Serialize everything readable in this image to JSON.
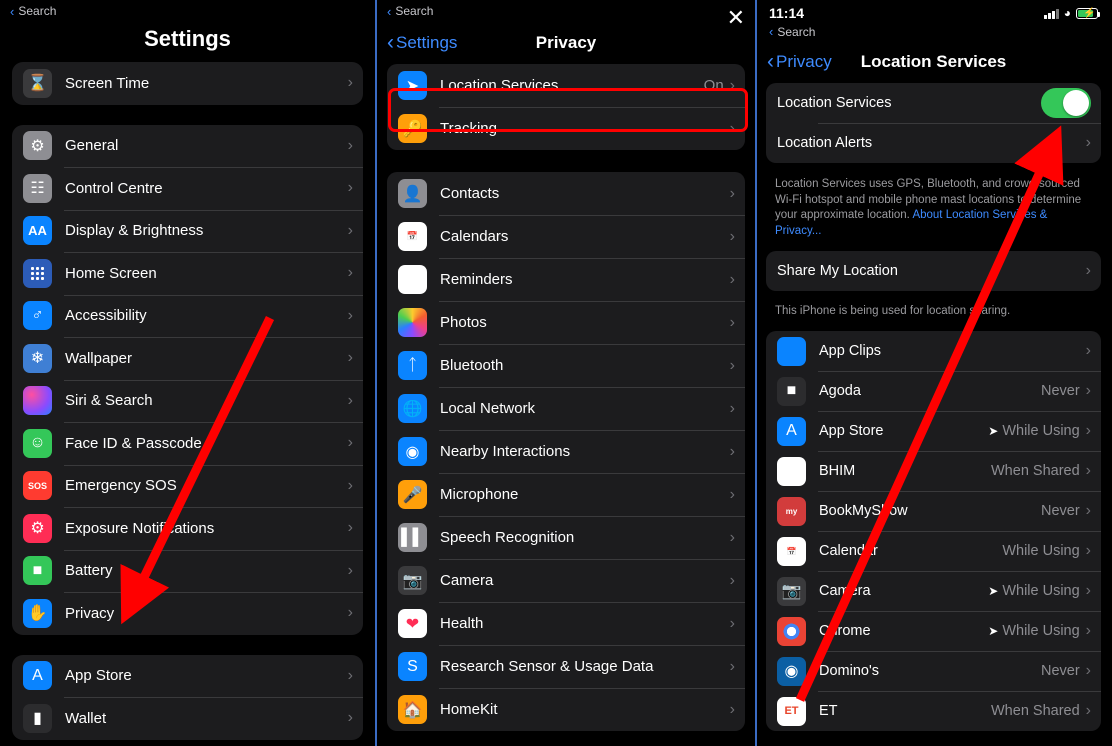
{
  "colors": {
    "accent_blue": "#0a84ff",
    "tint_blue": "#3e8bff",
    "green": "#34c759",
    "highlight_red": "#ff0000",
    "panel_bg": "#1c1c1e",
    "secondary_text": "#8e8e93"
  },
  "panel1": {
    "search_remnant": "Search",
    "title": "Settings",
    "group1": [
      {
        "label": "Screen Time",
        "icon": "hourglass-icon",
        "value": "",
        "chevron": "›"
      }
    ],
    "group2": [
      {
        "label": "General",
        "icon": "gear-icon",
        "value": "",
        "chevron": "›"
      },
      {
        "label": "Control Centre",
        "icon": "control-centre-icon",
        "value": "",
        "chevron": "›"
      },
      {
        "label": "Display & Brightness",
        "icon": "display-brightness-icon",
        "value": "",
        "chevron": "›"
      },
      {
        "label": "Home Screen",
        "icon": "home-screen-icon",
        "value": "",
        "chevron": "›"
      },
      {
        "label": "Accessibility",
        "icon": "accessibility-icon",
        "value": "",
        "chevron": "›"
      },
      {
        "label": "Wallpaper",
        "icon": "wallpaper-icon",
        "value": "",
        "chevron": "›"
      },
      {
        "label": "Siri & Search",
        "icon": "siri-icon",
        "value": "",
        "chevron": "›"
      },
      {
        "label": "Face ID & Passcode",
        "icon": "face-id-icon",
        "value": "",
        "chevron": "›"
      },
      {
        "label": "Emergency SOS",
        "icon": "sos-icon",
        "value": "",
        "chevron": "›"
      },
      {
        "label": "Exposure Notifications",
        "icon": "exposure-notifications-icon",
        "value": "",
        "chevron": "›"
      },
      {
        "label": "Battery",
        "icon": "battery-icon",
        "value": "",
        "chevron": "›"
      },
      {
        "label": "Privacy",
        "icon": "privacy-hand-icon",
        "value": "",
        "chevron": "›"
      }
    ],
    "group3": [
      {
        "label": "App Store",
        "icon": "app-store-icon",
        "value": "",
        "chevron": "›"
      },
      {
        "label": "Wallet",
        "icon": "wallet-icon",
        "value": "",
        "chevron": "›"
      }
    ]
  },
  "panel2": {
    "search_remnant": "Search",
    "back_label": "Settings",
    "title": "Privacy",
    "close_glyph": "✕",
    "group1": [
      {
        "label": "Location Services",
        "icon": "location-arrow-icon",
        "value": "On",
        "chevron": "›"
      },
      {
        "label": "Tracking",
        "icon": "tracking-icon",
        "value": "",
        "chevron": "›"
      }
    ],
    "group2": [
      {
        "label": "Contacts",
        "icon": "contacts-icon",
        "value": "",
        "chevron": "›"
      },
      {
        "label": "Calendars",
        "icon": "calendars-icon",
        "value": "",
        "chevron": "›"
      },
      {
        "label": "Reminders",
        "icon": "reminders-icon",
        "value": "",
        "chevron": "›"
      },
      {
        "label": "Photos",
        "icon": "photos-icon",
        "value": "",
        "chevron": "›"
      },
      {
        "label": "Bluetooth",
        "icon": "bluetooth-icon",
        "value": "",
        "chevron": "›"
      },
      {
        "label": "Local Network",
        "icon": "local-network-icon",
        "value": "",
        "chevron": "›"
      },
      {
        "label": "Nearby Interactions",
        "icon": "nearby-interactions-icon",
        "value": "",
        "chevron": "›"
      },
      {
        "label": "Microphone",
        "icon": "microphone-icon",
        "value": "",
        "chevron": "›"
      },
      {
        "label": "Speech Recognition",
        "icon": "speech-recognition-icon",
        "value": "",
        "chevron": "›"
      },
      {
        "label": "Camera",
        "icon": "camera-icon",
        "value": "",
        "chevron": "›"
      },
      {
        "label": "Health",
        "icon": "health-heart-icon",
        "value": "",
        "chevron": "›"
      },
      {
        "label": "Research Sensor & Usage Data",
        "icon": "research-sensor-icon",
        "value": "",
        "chevron": "›"
      },
      {
        "label": "HomeKit",
        "icon": "homekit-icon",
        "value": "",
        "chevron": "›"
      }
    ]
  },
  "panel3": {
    "status": {
      "time": "11:14",
      "search_remnant": "Search"
    },
    "back_label": "Privacy",
    "title": "Location Services",
    "group1": [
      {
        "label": "Location Services",
        "control": "toggle-on"
      },
      {
        "label": "Location Alerts",
        "chevron": "›"
      }
    ],
    "footnote_prefix": "Location Services uses GPS, Bluetooth, and crowd-sourced Wi-Fi hotspot and mobile phone mast locations to determine your approximate location. ",
    "footnote_link": "About Location Services & Privacy...",
    "share": {
      "label": "Share My Location",
      "chevron": "›"
    },
    "share_footnote": "This iPhone is being used for location sharing.",
    "apps": [
      {
        "label": "App Clips",
        "icon": "app-clips-icon",
        "value": "",
        "arrow": false,
        "chevron": "›"
      },
      {
        "label": "Agoda",
        "icon": "agoda-icon",
        "value": "Never",
        "arrow": false,
        "chevron": "›"
      },
      {
        "label": "App Store",
        "icon": "app-store-icon",
        "value": "While Using",
        "arrow": true,
        "chevron": "›"
      },
      {
        "label": "BHIM",
        "icon": "bhim-icon",
        "value": "When Shared",
        "arrow": false,
        "chevron": "›"
      },
      {
        "label": "BookMyShow",
        "icon": "bookmyshow-icon",
        "value": "Never",
        "arrow": false,
        "chevron": "›"
      },
      {
        "label": "Calendar",
        "icon": "calendar-icon",
        "value": "While Using",
        "arrow": false,
        "chevron": "›"
      },
      {
        "label": "Camera",
        "icon": "camera-icon",
        "value": "While Using",
        "arrow": true,
        "chevron": "›"
      },
      {
        "label": "Chrome",
        "icon": "chrome-icon",
        "value": "While Using",
        "arrow": true,
        "chevron": "›"
      },
      {
        "label": "Domino's",
        "icon": "dominos-icon",
        "value": "Never",
        "arrow": false,
        "chevron": "›"
      },
      {
        "label": "ET",
        "icon": "et-icon",
        "value": "When Shared",
        "arrow": false,
        "chevron": "›"
      }
    ]
  },
  "annotations": {
    "highlight_box_target": "Location Services",
    "arrow1_target": "Privacy",
    "arrow2_target": "Location Services toggle"
  }
}
